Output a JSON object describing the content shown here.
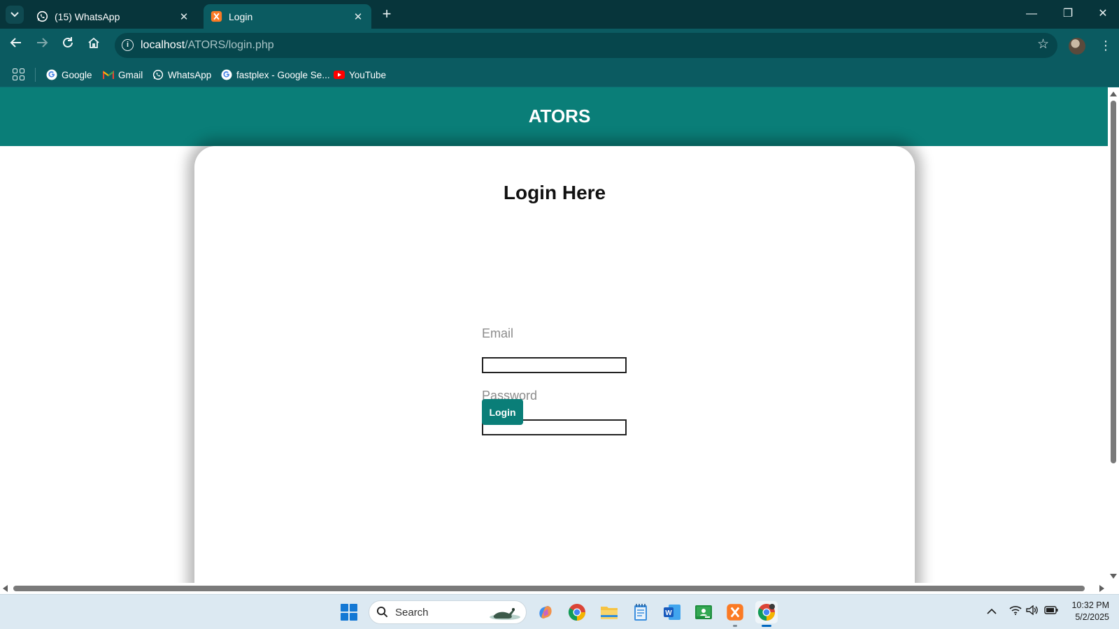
{
  "browser": {
    "tabs": [
      {
        "title": "(15) WhatsApp",
        "active": false,
        "icon": "whatsapp-icon"
      },
      {
        "title": "Login",
        "active": true,
        "icon": "xampp-icon"
      }
    ],
    "tab_close_glyph": "✕",
    "new_tab_glyph": "+",
    "window_controls": {
      "minimize": "—",
      "restore": "❐",
      "close": "✕"
    },
    "url": {
      "host": "localhost",
      "path": "/ATORS/login.php"
    },
    "bookmarks": [
      {
        "label": "Google",
        "icon": "google-icon"
      },
      {
        "label": "Gmail",
        "icon": "gmail-icon"
      },
      {
        "label": "WhatsApp",
        "icon": "whatsapp-icon"
      },
      {
        "label": "fastplex - Google Se...",
        "icon": "google-icon"
      },
      {
        "label": "YouTube",
        "icon": "youtube-icon"
      }
    ]
  },
  "page": {
    "site_title": "ATORS",
    "heading": "Login Here",
    "email_label": "Email",
    "email_value": "",
    "password_label": "Password",
    "password_value": "",
    "login_button": "Login",
    "accent_color": "#0a7e78"
  },
  "taskbar": {
    "search_label": "Search",
    "apps": [
      "copilot-icon",
      "chrome-icon",
      "file-explorer-icon",
      "notepad-icon",
      "word-icon",
      "classroom-icon",
      "xampp-icon",
      "chrome-icon"
    ],
    "clock": {
      "time": "10:32 PM",
      "date": "5/2/2025"
    }
  }
}
